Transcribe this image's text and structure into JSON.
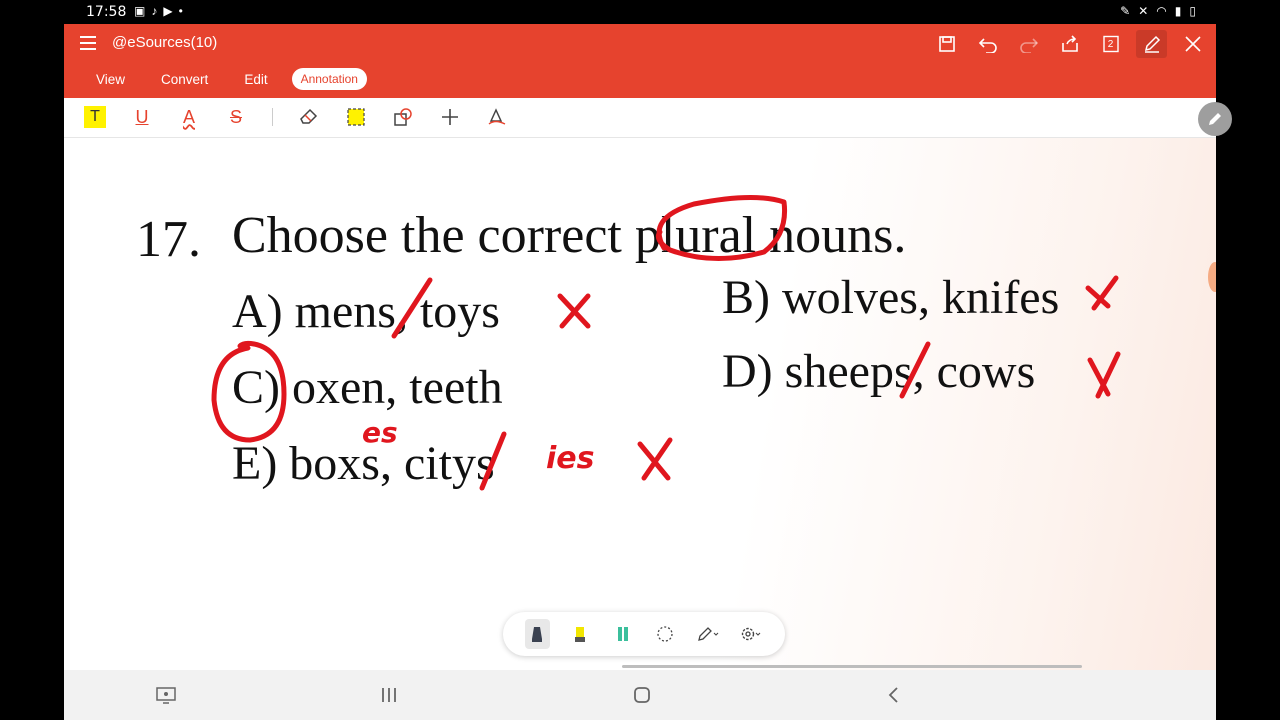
{
  "status_bar": {
    "time": "17:58",
    "left_icons": [
      "gallery-icon",
      "tiktok-icon",
      "video-icon",
      "dot-icon"
    ],
    "right_icons": [
      "edit-icon",
      "mute-icon",
      "wifi-icon",
      "signal-icon",
      "battery-icon"
    ]
  },
  "header": {
    "doc_title": "@eSources(10)",
    "page_badge": "2",
    "tabs": [
      {
        "label": "View"
      },
      {
        "label": "Convert"
      },
      {
        "label": "Edit"
      },
      {
        "label": "Annotation",
        "active": true
      }
    ],
    "icons": [
      "save-icon",
      "undo-icon",
      "redo-icon",
      "share-icon",
      "page-count-icon",
      "pen-edit-icon",
      "close-icon"
    ]
  },
  "annotation_tools": {
    "highlight_glyph": "T",
    "underline_glyph": "U",
    "squiggly_glyph": "A",
    "strike_glyph": "S",
    "icons": [
      "highlight-text-icon",
      "underline-icon",
      "squiggly-icon",
      "strikethrough-icon",
      "eraser-icon",
      "area-highlight-icon",
      "shape-icon",
      "plus-icon",
      "signature-icon"
    ]
  },
  "document": {
    "question_number": "17.",
    "question_text": "Choose the correct plural nouns.",
    "options": {
      "a": "A) mens, toys",
      "b": "B) wolves, knifes",
      "c": "C) oxen, teeth",
      "d": "D) sheeps, cows",
      "e": "E) boxs, citys"
    },
    "handwritten": {
      "box_correction": "es",
      "city_correction": "ies"
    },
    "ink_color": "#e0161e"
  },
  "pen_toolbar": {
    "icons": [
      "marker-pen-icon",
      "yellow-highlighter-icon",
      "green-highlighter-icon",
      "lasso-icon",
      "pen-settings-icon",
      "gear-icon"
    ]
  },
  "nav_bar": {
    "icons": [
      "screen-icon",
      "recents-icon",
      "home-icon",
      "back-icon"
    ]
  }
}
